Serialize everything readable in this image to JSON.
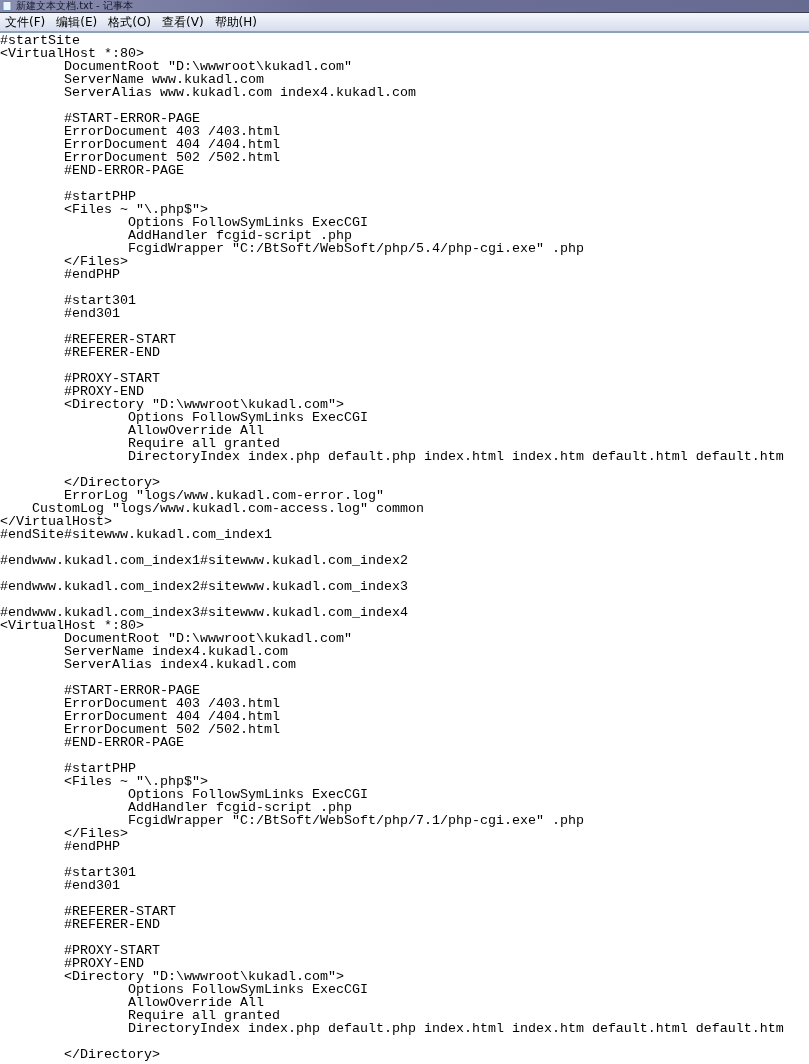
{
  "window": {
    "title": "新建文本文档.txt - 记事本"
  },
  "menu": [
    "文件(F)",
    "编辑(E)",
    "格式(O)",
    "查看(V)",
    "帮助(H)"
  ],
  "paragraphs": [
    [
      "#startSite",
      "<VirtualHost *:80>",
      "\tDocumentRoot \"D:\\wwwroot\\kukadl.com\"",
      "\tServerName www.kukadl.com",
      "\tServerAlias www.kukadl.com index4.kukadl.com"
    ],
    [
      "\t#START-ERROR-PAGE",
      "\tErrorDocument 403 /403.html",
      "\tErrorDocument 404 /404.html",
      "\tErrorDocument 502 /502.html",
      "\t#END-ERROR-PAGE"
    ],
    [
      "\t#startPHP",
      "\t<Files ~ \"\\.php$\">",
      "\t\tOptions FollowSymLinks ExecCGI",
      "\t\tAddHandler fcgid-script .php",
      "\t\tFcgidWrapper \"C:/BtSoft/WebSoft/php/5.4/php-cgi.exe\" .php",
      "\t</Files>",
      "\t#endPHP"
    ],
    [
      "\t#start301",
      "\t#end301"
    ],
    [
      "\t#REFERER-START",
      "\t#REFERER-END"
    ],
    [
      "\t#PROXY-START",
      "\t#PROXY-END",
      "\t<Directory \"D:\\wwwroot\\kukadl.com\">",
      "\t\tOptions FollowSymLinks ExecCGI",
      "\t\tAllowOverride All",
      "\t\tRequire all granted",
      "\t\tDirectoryIndex index.php default.php index.html index.htm default.html default.htm"
    ],
    [
      "\t</Directory>",
      "\tErrorLog \"logs/www.kukadl.com-error.log\"",
      "    CustomLog \"logs/www.kukadl.com-access.log\" common",
      "</VirtualHost>",
      "#endSite#sitewww.kukadl.com_index1"
    ],
    [
      "#endwww.kukadl.com_index1#sitewww.kukadl.com_index2"
    ],
    [
      "#endwww.kukadl.com_index2#sitewww.kukadl.com_index3"
    ],
    [
      "#endwww.kukadl.com_index3#sitewww.kukadl.com_index4",
      "<VirtualHost *:80>",
      "\tDocumentRoot \"D:\\wwwroot\\kukadl.com\"",
      "\tServerName index4.kukadl.com",
      "\tServerAlias index4.kukadl.com"
    ],
    [
      "\t#START-ERROR-PAGE",
      "\tErrorDocument 403 /403.html",
      "\tErrorDocument 404 /404.html",
      "\tErrorDocument 502 /502.html",
      "\t#END-ERROR-PAGE"
    ],
    [
      "\t#startPHP",
      "\t<Files ~ \"\\.php$\">",
      "\t\tOptions FollowSymLinks ExecCGI",
      "\t\tAddHandler fcgid-script .php",
      "\t\tFcgidWrapper \"C:/BtSoft/WebSoft/php/7.1/php-cgi.exe\" .php",
      "\t</Files>",
      "\t#endPHP"
    ],
    [
      "\t#start301",
      "\t#end301"
    ],
    [
      "\t#REFERER-START",
      "\t#REFERER-END"
    ],
    [
      "\t#PROXY-START",
      "\t#PROXY-END",
      "\t<Directory \"D:\\wwwroot\\kukadl.com\">",
      "\t\tOptions FollowSymLinks ExecCGI",
      "\t\tAllowOverride All",
      "\t\tRequire all granted",
      "\t\tDirectoryIndex index.php default.php index.html index.htm default.html default.htm"
    ],
    [
      "\t</Directory>"
    ]
  ]
}
